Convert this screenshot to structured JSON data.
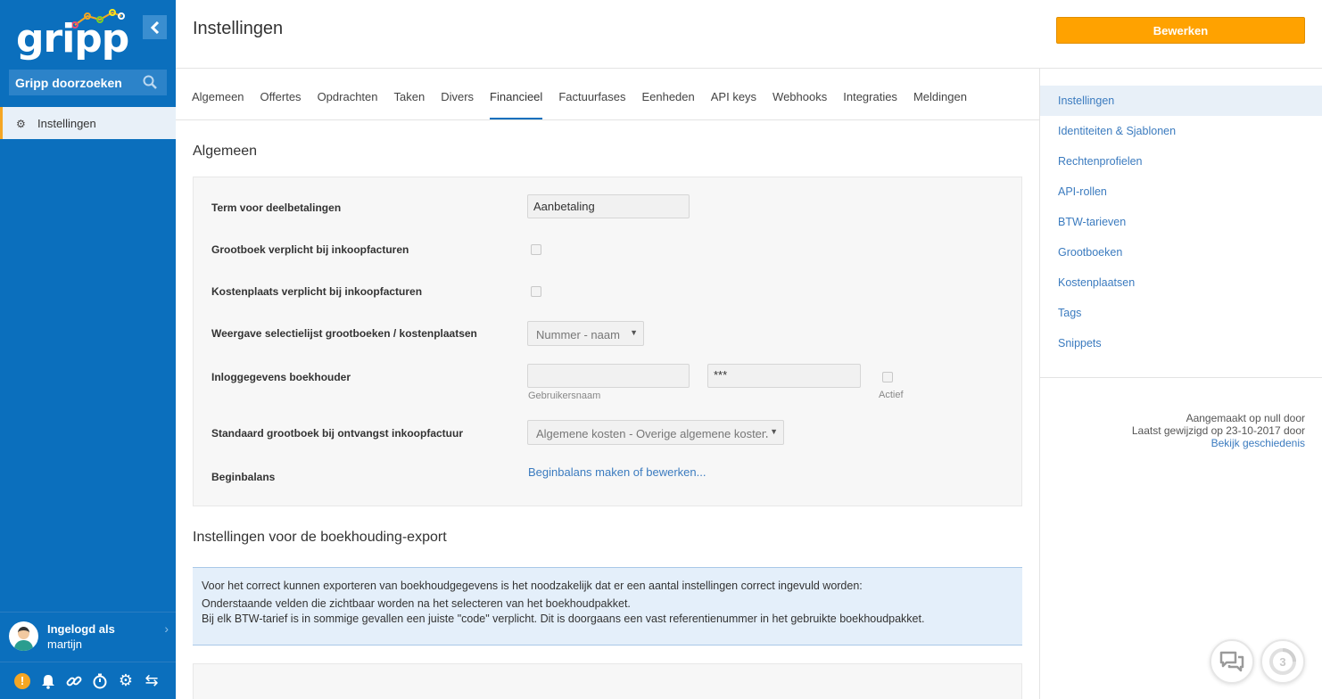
{
  "sidebar": {
    "logo_text": "gripp",
    "search": {
      "placeholder": "Gripp doorzoeken"
    },
    "items": [
      {
        "label": "Instellingen"
      }
    ],
    "user": {
      "line1": "Ingelogd als",
      "line2": "martijn"
    },
    "bottom_icons": [
      "alert-icon",
      "bell-icon",
      "link-icon",
      "timer-icon",
      "gear-icon",
      "swap-icon"
    ],
    "alert_symbol": "!"
  },
  "header": {
    "title": "Instellingen",
    "edit_label": "Bewerken"
  },
  "tabs": [
    {
      "label": "Algemeen"
    },
    {
      "label": "Offertes"
    },
    {
      "label": "Opdrachten"
    },
    {
      "label": "Taken"
    },
    {
      "label": "Divers"
    },
    {
      "label": "Financieel",
      "active": true
    },
    {
      "label": "Factuurfases"
    },
    {
      "label": "Eenheden"
    },
    {
      "label": "API keys"
    },
    {
      "label": "Webhooks"
    },
    {
      "label": "Integraties"
    },
    {
      "label": "Meldingen"
    }
  ],
  "section1": {
    "title": "Algemeen",
    "rows": {
      "term": {
        "label": "Term voor deelbetalingen",
        "value": "Aanbetaling"
      },
      "grootboek_verplicht": {
        "label": "Grootboek verplicht bij inkoopfacturen"
      },
      "kostenplaats_verplicht": {
        "label": "Kostenplaats verplicht bij inkoopfacturen"
      },
      "weergave": {
        "label": "Weergave selectielijst grootboeken / kostenplaatsen",
        "value": "Nummer - naam"
      },
      "inlog": {
        "label": "Inloggegevens boekhouder",
        "username_value": "",
        "username_hint": "Gebruikersnaam",
        "password_value": "***",
        "active_hint": "Actief"
      },
      "standaard": {
        "label": "Standaard grootboek bij ontvangst inkoopfactuur",
        "value": "Algemene kosten - Overige algemene kosten"
      },
      "beginbalans": {
        "label": "Beginbalans",
        "link": "Beginbalans maken of bewerken..."
      }
    }
  },
  "section2": {
    "title": "Instellingen voor de boekhouding-export",
    "info_line1": "Voor het correct kunnen exporteren van boekhoudgegevens is het noodzakelijk dat er een aantal instellingen correct ingevuld worden:",
    "info_line2": "Onderstaande velden die zichtbaar worden na het selecteren van het boekhoudpakket.",
    "info_line3": "Bij elk BTW-tarief is in sommige gevallen een juiste \"code\" verplicht. Dit is doorgaans een vast referentienummer in het gebruikte boekhoudpakket."
  },
  "right_nav": {
    "items": [
      {
        "label": "Instellingen",
        "active": true
      },
      {
        "label": "Identiteiten & Sjablonen"
      },
      {
        "label": "Rechtenprofielen"
      },
      {
        "label": "API-rollen"
      },
      {
        "label": "BTW-tarieven"
      },
      {
        "label": "Grootboeken"
      },
      {
        "label": "Kostenplaatsen"
      },
      {
        "label": "Tags"
      },
      {
        "label": "Snippets"
      }
    ],
    "meta": {
      "created": "Aangemaakt op null door",
      "modified": "Laatst gewijzigd op 23-10-2017 door",
      "history_link": "Bekijk geschiedenis"
    }
  },
  "floating": {
    "badge_count": "3"
  },
  "colors": {
    "sidebar_bg": "#0b6fbd",
    "accent": "#ffa200",
    "link": "#3b7bbf"
  }
}
